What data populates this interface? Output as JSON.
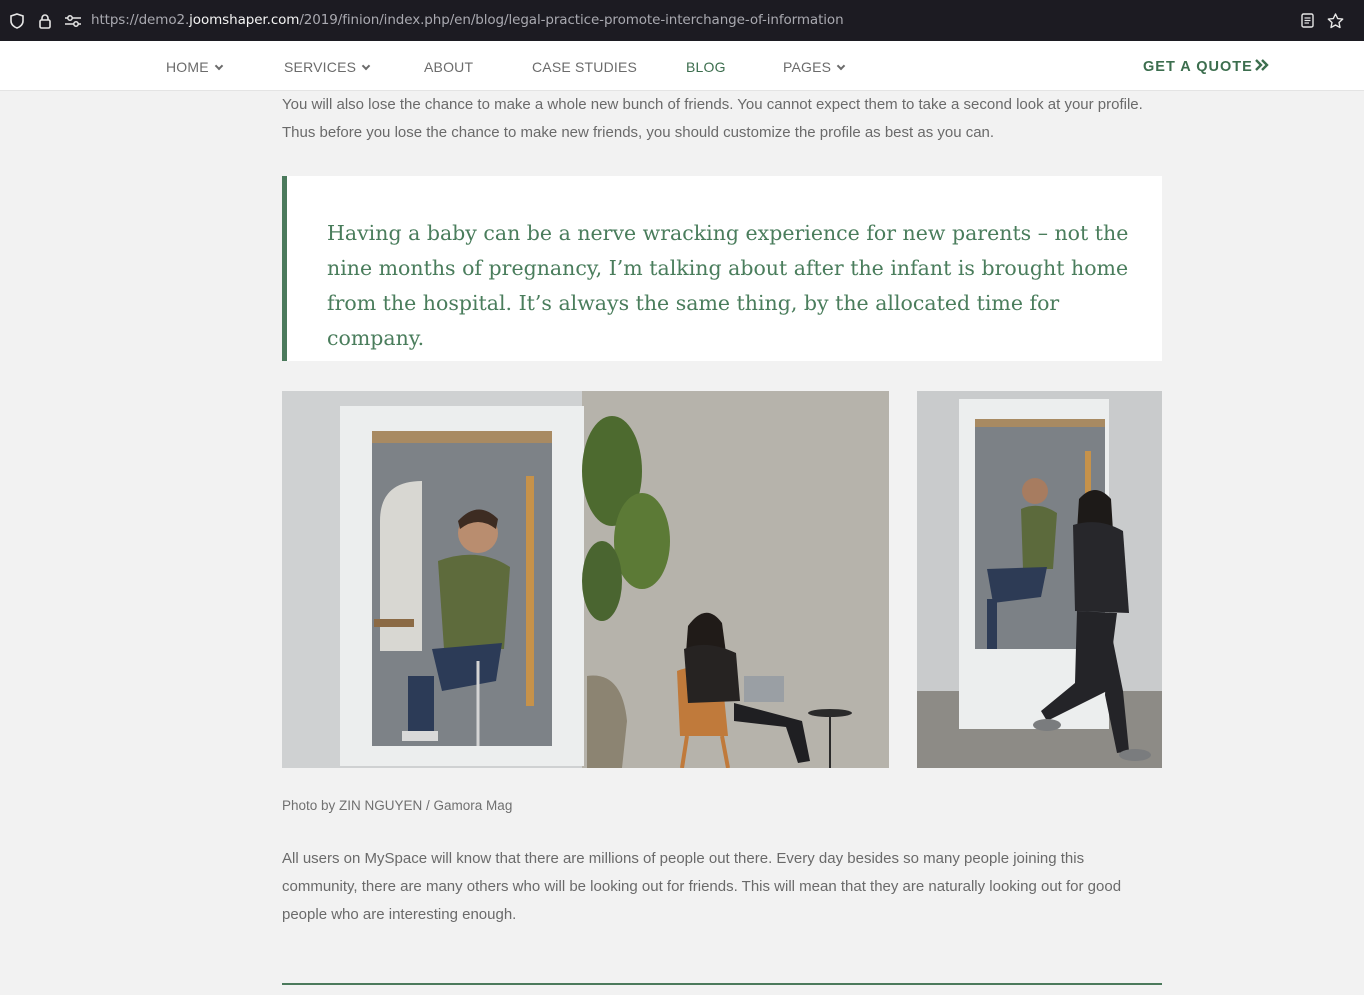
{
  "browser": {
    "url_prefix": "https://demo2.",
    "url_host": "joomshaper.com",
    "url_path": "/2019/finion/index.php/en/blog/legal-practice-promote-interchange-of-information"
  },
  "nav": {
    "items": [
      {
        "label": "HOME",
        "has_dropdown": true
      },
      {
        "label": "SERVICES",
        "has_dropdown": true
      },
      {
        "label": "ABOUT",
        "has_dropdown": false
      },
      {
        "label": "CASE STUDIES",
        "has_dropdown": false
      },
      {
        "label": "BLOG",
        "has_dropdown": false,
        "active": true
      },
      {
        "label": "PAGES",
        "has_dropdown": true
      }
    ],
    "cta": "GET A QUOTE"
  },
  "article": {
    "para1": "You will also lose the chance to make a whole new bunch of friends. You cannot expect them to take a second look at your profile. Thus before you lose the chance to make new friends, you should customize the profile as best as you can.",
    "blockquote": "Having a baby can be a nerve wracking experience for new parents – not the nine months of pregnancy, I’m talking about after the infant is brought home from the hospital. It’s always the same thing, by the allocated time for company.",
    "caption": "Photo by ZIN NGUYEN / Gamora Mag",
    "para2": "All users on MySpace will know that there are millions of people out there. Every day besides so many people joining this community, there are many others who will be looking out for friends. This will mean that they are naturally looking out for good people who are interesting enough."
  },
  "colors": {
    "accent": "#4b7a5c",
    "text": "#6a6a6a",
    "page_bg": "#f2f2f2"
  }
}
